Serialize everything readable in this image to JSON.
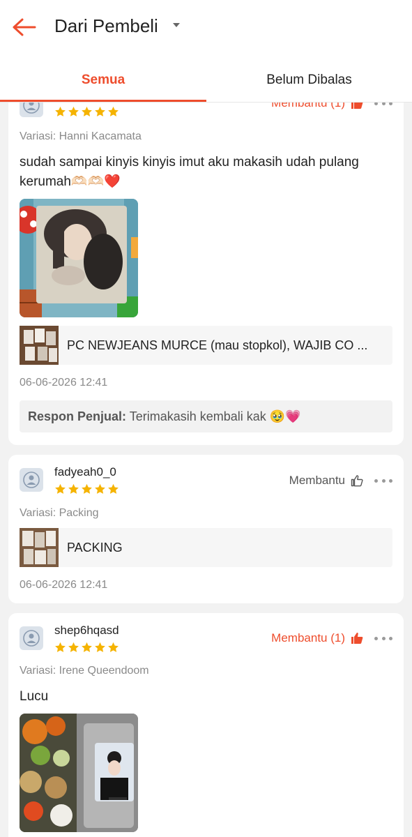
{
  "header": {
    "title": "Dari Pembeli",
    "tabs": [
      "Semua",
      "Belum Dibalas"
    ]
  },
  "colors": {
    "accent": "#ee4d2d",
    "star": "#f5b300"
  },
  "reviews": [
    {
      "username": "",
      "rating": 5,
      "helpful_label": "Membantu (1)",
      "variation": "Variasi: Hanni Kacamata",
      "text": "sudah sampai kinyis kinyis imut aku makasih udah pulang kerumah",
      "emoji": "🫶🏻🫶🏻",
      "heart": "❤️",
      "product_name": "PC NEWJEANS MURCE (mau stopkol), WAJIB CO ...",
      "date": "06-06-2026 12:41",
      "reply_label": "Respon Penjual:",
      "reply_text": "Terimakasih kembali kak 🥹💗"
    },
    {
      "username": "fadyeah0_0",
      "rating": 5,
      "helpful_label": "Membantu",
      "variation": "Variasi: Packing",
      "product_name": "PACKING",
      "date": "06-06-2026 12:41"
    },
    {
      "username": "shep6hqasd",
      "rating": 5,
      "helpful_label": "Membantu (1)",
      "variation": "Variasi: Irene Queendoom",
      "text": "Lucu"
    }
  ]
}
